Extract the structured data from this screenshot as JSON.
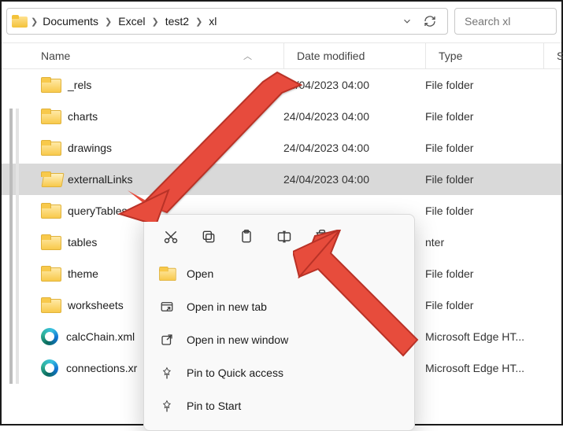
{
  "address": {
    "crumbs": [
      "Documents",
      "Excel",
      "test2",
      "xl"
    ]
  },
  "search": {
    "placeholder": "Search xl"
  },
  "columns": {
    "name": "Name",
    "date": "Date modified",
    "type": "Type",
    "tail": "S"
  },
  "rows": [
    {
      "icon": "folder",
      "name": "_rels",
      "date": "24/04/2023 04:00",
      "type": "File folder",
      "selected": false
    },
    {
      "icon": "folder",
      "name": "charts",
      "date": "24/04/2023 04:00",
      "type": "File folder",
      "selected": false
    },
    {
      "icon": "folder",
      "name": "drawings",
      "date": "24/04/2023 04:00",
      "type": "File folder",
      "selected": false
    },
    {
      "icon": "folder-open",
      "name": "externalLinks",
      "date": "24/04/2023 04:00",
      "type": "File folder",
      "selected": true
    },
    {
      "icon": "folder",
      "name": "queryTables",
      "date": "",
      "type": "File folder",
      "selected": false
    },
    {
      "icon": "folder",
      "name": "tables",
      "date": "",
      "type": "nter",
      "selected": false
    },
    {
      "icon": "folder",
      "name": "theme",
      "date": "",
      "type": "File folder",
      "selected": false
    },
    {
      "icon": "folder",
      "name": "worksheets",
      "date": "",
      "type": "File folder",
      "selected": false
    },
    {
      "icon": "edge",
      "name": "calcChain.xml",
      "date": "",
      "type": "Microsoft Edge HT...",
      "selected": false
    },
    {
      "icon": "edge",
      "name": "connections.xr",
      "date": "",
      "type": "Microsoft Edge HT...",
      "selected": false
    }
  ],
  "context": {
    "iconbar": [
      "cut",
      "copy",
      "paste",
      "rename",
      "delete"
    ],
    "items": [
      {
        "icon": "open",
        "label": "Open"
      },
      {
        "icon": "newtab",
        "label": "Open in new tab"
      },
      {
        "icon": "newwindow",
        "label": "Open in new window"
      },
      {
        "icon": "pin",
        "label": "Pin to Quick access"
      },
      {
        "icon": "pin",
        "label": "Pin to Start"
      }
    ]
  }
}
